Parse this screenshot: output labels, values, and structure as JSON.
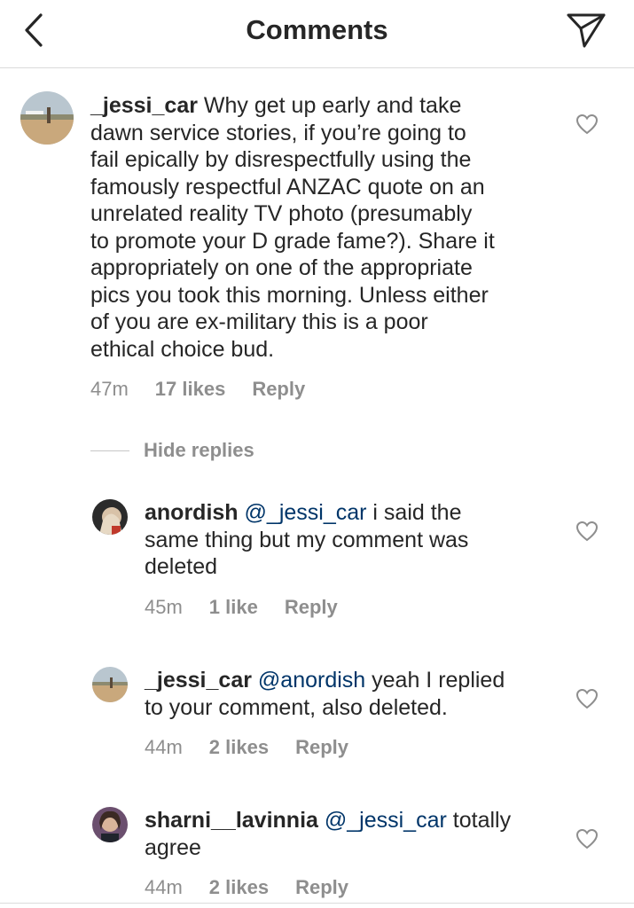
{
  "header": {
    "title": "Comments",
    "back_icon": "chevron-left-icon",
    "share_icon": "paper-plane-icon"
  },
  "comments": [
    {
      "username": "_jessi_car",
      "lines": [
        "Why get up early and take",
        "dawn service stories, if you’re going to",
        "fail epically by disrespectfully using the",
        "famously respectful ANZAC quote on an",
        "unrelated reality TV photo (presumably",
        "to promote your D grade fame?). Share it",
        "appropriately on one of the appropriate",
        "pics you took this morning. Unless either",
        "of you are ex-military this is a poor",
        "ethical choice bud."
      ],
      "time": "47m",
      "likes": "17 likes",
      "reply": "Reply"
    }
  ],
  "hide_replies": "Hide replies",
  "replies": [
    {
      "username": "anordish",
      "mention": "@_jessi_car",
      "lines": [
        "i said the",
        "same thing but my comment was",
        "deleted"
      ],
      "time": "45m",
      "likes": "1 like",
      "reply": "Reply"
    },
    {
      "username": "_jessi_car",
      "mention": "@anordish",
      "lines": [
        "yeah I replied",
        "to your comment, also deleted."
      ],
      "time": "44m",
      "likes": "2 likes",
      "reply": "Reply"
    },
    {
      "username": "sharni__lavinnia",
      "mention": "@_jessi_car",
      "lines": [
        "totally",
        "agree"
      ],
      "time": "44m",
      "likes": "2 likes",
      "reply": "Reply"
    }
  ],
  "colors": {
    "text": "#262626",
    "secondary": "#8e8e8e",
    "mention": "#003569",
    "divider": "#dbdbdb"
  }
}
